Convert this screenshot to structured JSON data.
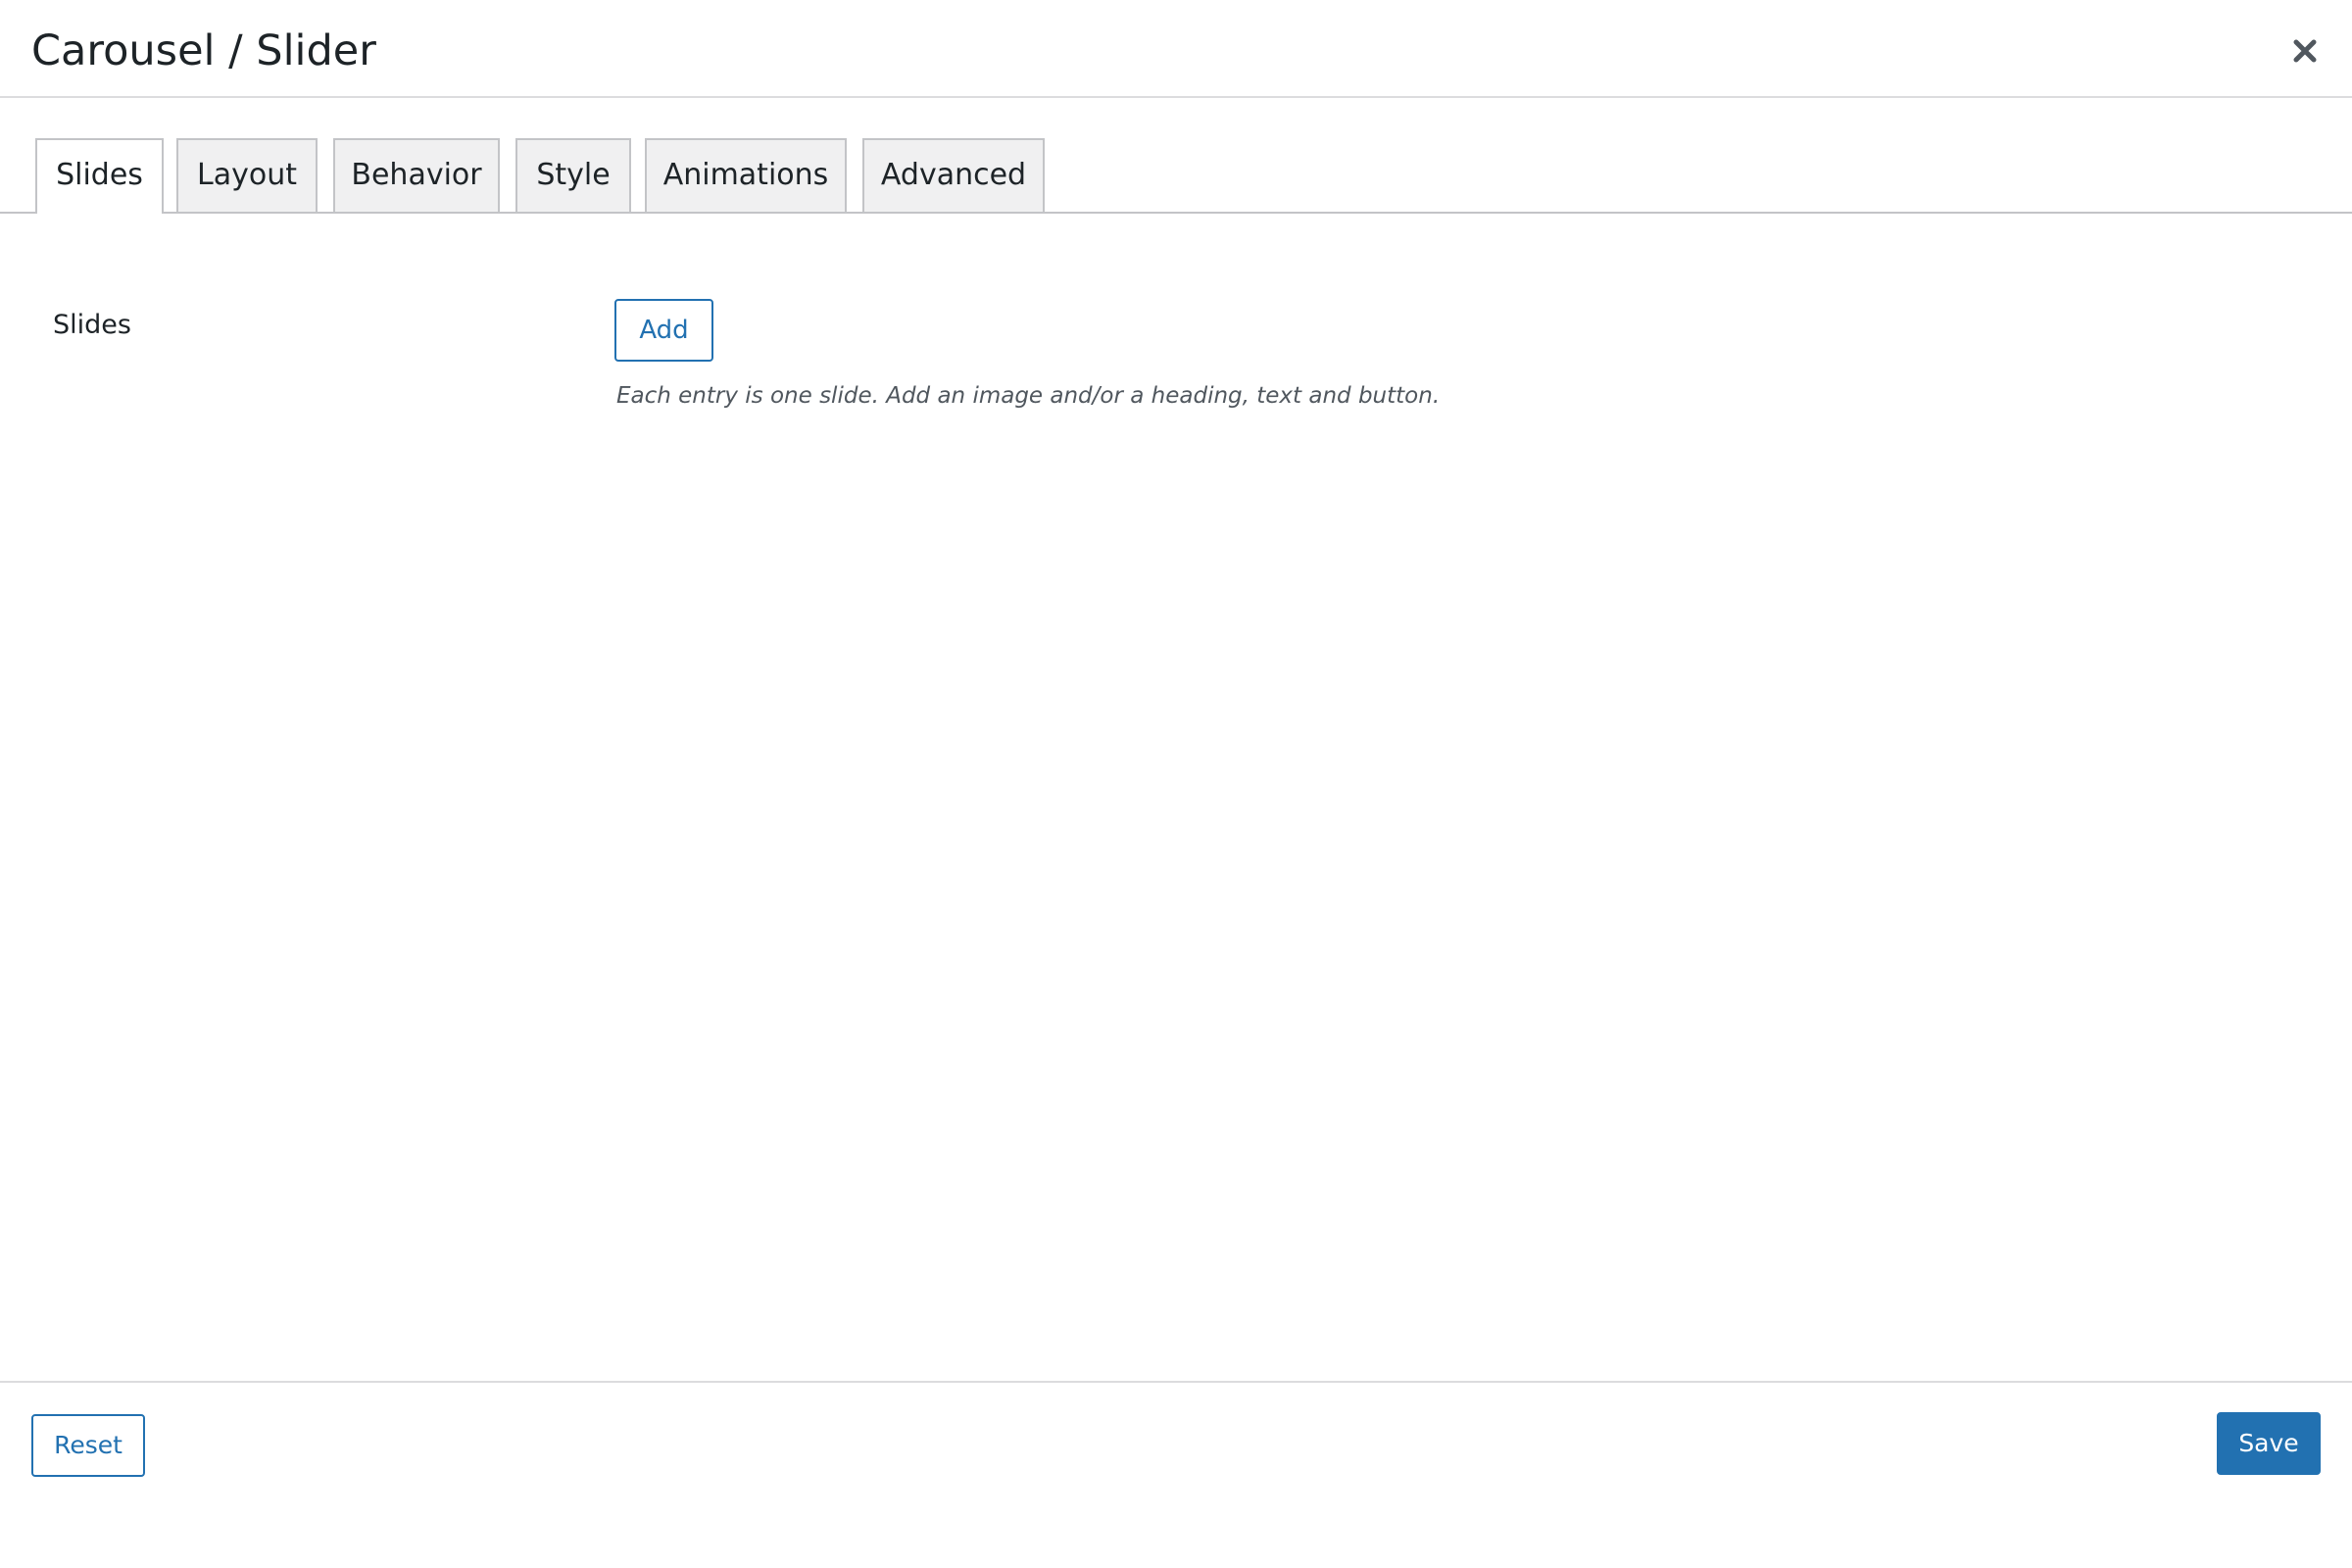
{
  "dialog": {
    "title": "Carousel / Slider",
    "close_icon": "close-icon"
  },
  "tabs": [
    {
      "label": "Slides",
      "active": true
    },
    {
      "label": "Layout",
      "active": false
    },
    {
      "label": "Behavior",
      "active": false
    },
    {
      "label": "Style",
      "active": false
    },
    {
      "label": "Animations",
      "active": false
    },
    {
      "label": "Advanced",
      "active": false
    }
  ],
  "slides_field": {
    "label": "Slides",
    "add_label": "Add",
    "help_text": "Each entry is one slide. Add an image and/or a heading, text and button."
  },
  "footer": {
    "reset_label": "Reset",
    "save_label": "Save"
  },
  "colors": {
    "accent": "#2271b1",
    "text": "#1d2327",
    "help_text": "#50575e",
    "tab_inactive_bg": "#f0f0f1",
    "border": "#c3c4c7"
  }
}
